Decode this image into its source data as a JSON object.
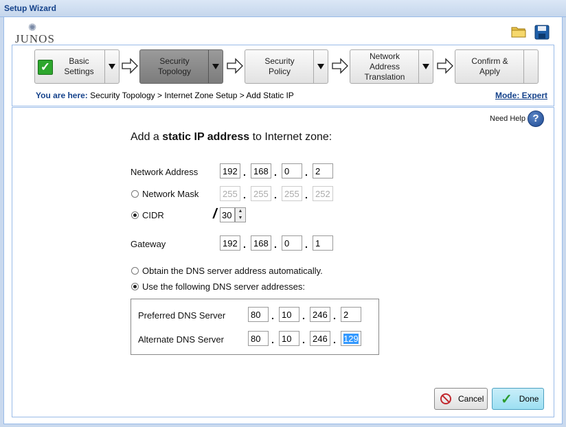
{
  "window": {
    "title": "Setup Wizard"
  },
  "logo": {
    "text": "JUNOS"
  },
  "steps": [
    {
      "label": "Basic\nSettings",
      "completed": true,
      "active": false
    },
    {
      "label": "Security\nTopology",
      "completed": false,
      "active": true
    },
    {
      "label": "Security\nPolicy",
      "completed": false,
      "active": false
    },
    {
      "label": "Network\nAddress\nTranslation",
      "completed": false,
      "active": false
    },
    {
      "label": "Confirm &\nApply",
      "completed": false,
      "active": false
    }
  ],
  "breadcrumb": {
    "label": "You are here:",
    "path": "Security Topology > Internet Zone Setup > Add Static IP"
  },
  "mode": "Mode: Expert",
  "help": {
    "label": "Need Help"
  },
  "form": {
    "heading_pre": "Add a ",
    "heading_bold": "static IP address",
    "heading_post": " to Internet zone:",
    "network_address": {
      "label": "Network Address",
      "octets": [
        "192",
        "168",
        "0",
        "2"
      ]
    },
    "network_mask": {
      "label": "Network Mask",
      "octets": [
        "255",
        "255",
        "255",
        "252"
      ],
      "selected": false
    },
    "cidr": {
      "label": "CIDR",
      "slash": "/",
      "value": "30",
      "selected": true
    },
    "gateway": {
      "label": "Gateway",
      "octets": [
        "192",
        "168",
        "0",
        "1"
      ]
    },
    "dns_auto": {
      "label": "Obtain the DNS server address automatically.",
      "selected": false
    },
    "dns_manual": {
      "label": "Use the following DNS server addresses:",
      "selected": true
    },
    "preferred_dns": {
      "label": "Preferred DNS Server",
      "octets": [
        "80",
        "10",
        "246",
        "2"
      ]
    },
    "alternate_dns": {
      "label": "Alternate DNS Server",
      "octets": [
        "80",
        "10",
        "246",
        "129"
      ]
    }
  },
  "buttons": {
    "cancel": "Cancel",
    "done": "Done"
  },
  "colors": {
    "accent": "#15428b",
    "border": "#99bbe8",
    "done_bg": "#9cdff2"
  }
}
